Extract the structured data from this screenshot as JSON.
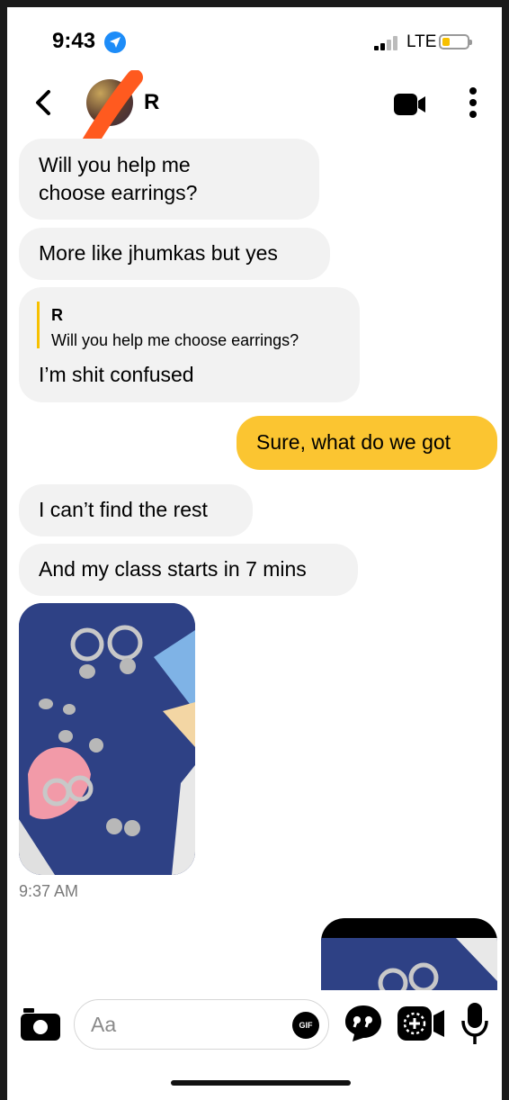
{
  "status": {
    "time": "9:43",
    "network": "LTE",
    "battery_fraction": 0.25,
    "battery_color": "#f7c000"
  },
  "header": {
    "contact_name": "R"
  },
  "messages": [
    {
      "text": "Will you help me choose earrings?"
    },
    {
      "text": "More like jhumkas but yes"
    },
    {
      "reply_to_name": "R",
      "reply_to_text": "Will you help me choose earrings?",
      "text": "I’m shit confused"
    },
    {
      "text": "Sure, what do we got"
    },
    {
      "text": "I can’t find the rest"
    },
    {
      "text": "And my class starts in 7 mins"
    }
  ],
  "photo_timestamp": "9:37 AM",
  "composer": {
    "placeholder": "Aa",
    "gif_label": "GIF"
  },
  "colors": {
    "accent": "#fbc531",
    "incoming_bubble": "#f2f2f2",
    "location": "#1d8cf8"
  }
}
